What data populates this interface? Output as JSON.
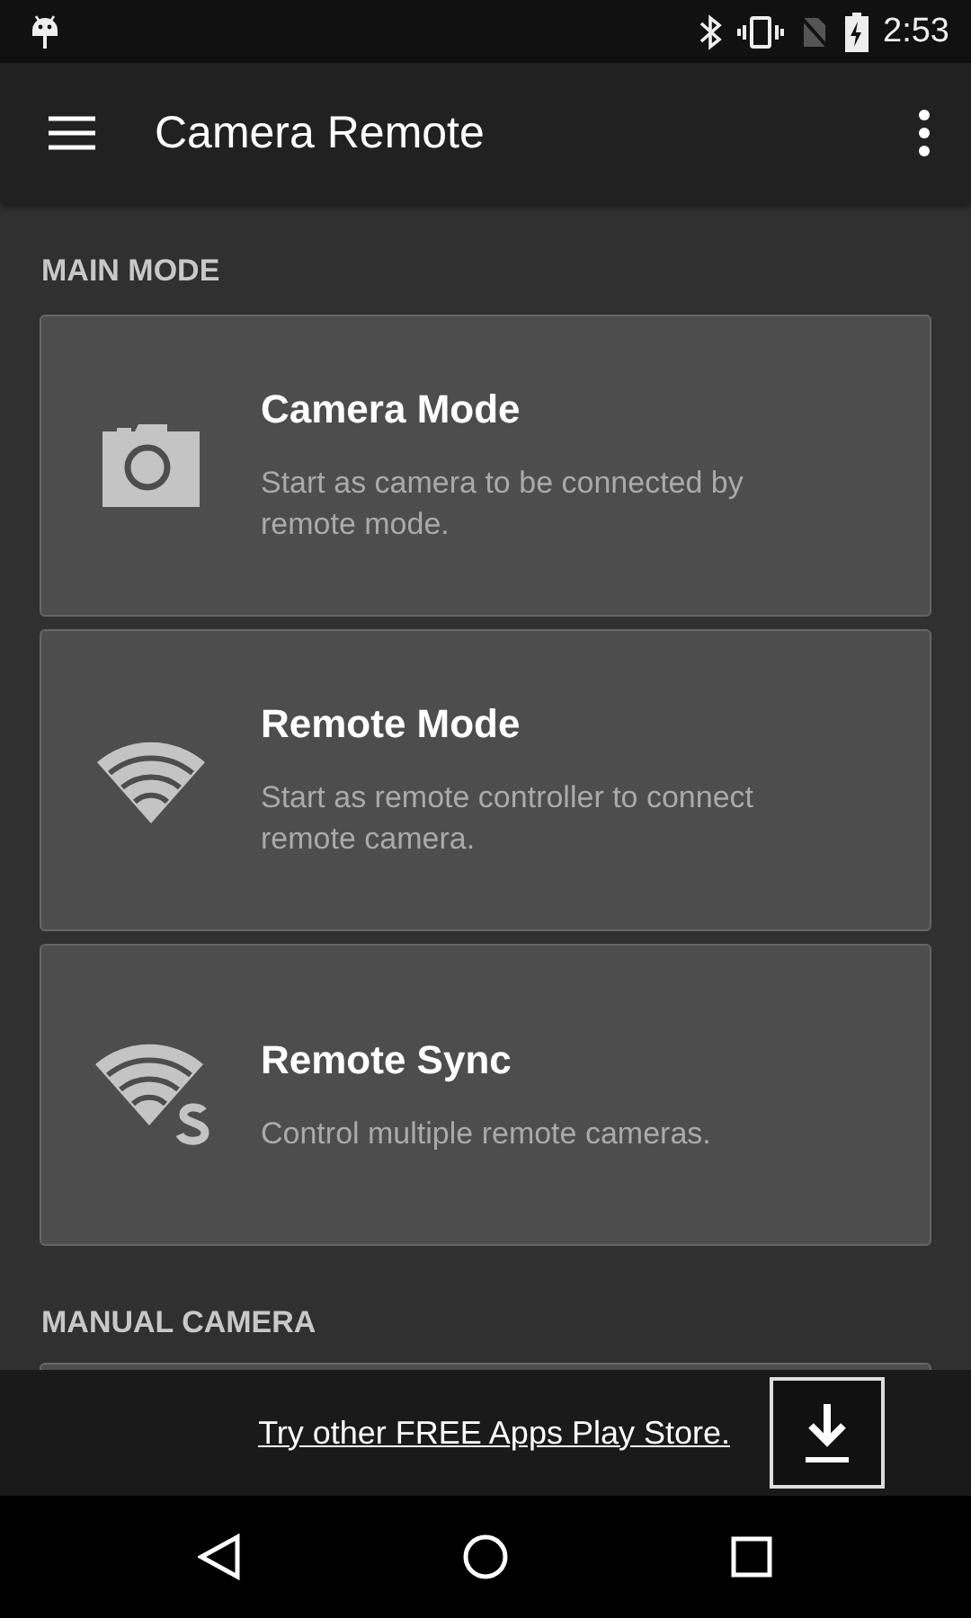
{
  "status_bar": {
    "time": "2:53"
  },
  "app_bar": {
    "title": "Camera Remote"
  },
  "sections": [
    {
      "title": "MAIN MODE",
      "cards": [
        {
          "kind": "camera",
          "title": "Camera Mode",
          "description": "Start as camera to be connected by remote mode."
        },
        {
          "kind": "wifi",
          "title": "Remote Mode",
          "description": "Start as remote controller to connect remote camera."
        },
        {
          "kind": "wifi-sync",
          "title": "Remote Sync",
          "description": "Control multiple remote cameras."
        }
      ]
    },
    {
      "title": "MANUAL CAMERA"
    }
  ],
  "ad_banner": {
    "text": "Try other FREE Apps Play Store."
  }
}
